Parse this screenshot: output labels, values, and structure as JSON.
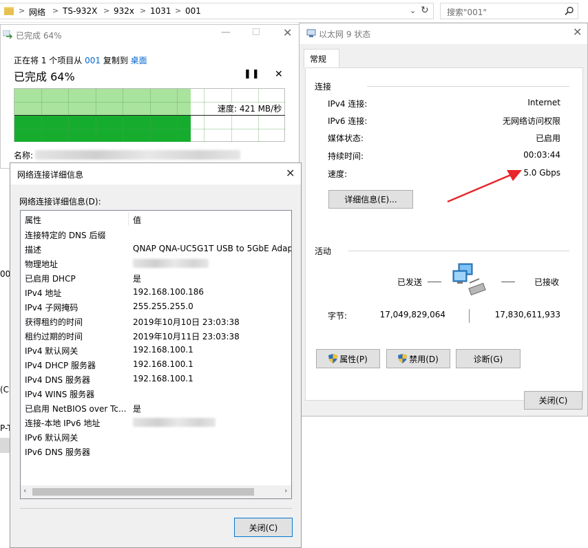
{
  "explorer": {
    "breadcrumb": [
      "网络",
      "TS-932X",
      "932x",
      "1031",
      "001"
    ],
    "search_placeholder": "搜索\"001\""
  },
  "copy_dialog": {
    "title": "已完成 64%",
    "desc_prefix": "正在将 1 个项目从",
    "desc_source": "001",
    "desc_mid": "复制到",
    "desc_dest": "桌面",
    "heading": "已完成 64%",
    "speed_label": "速度: 421 MB/秒",
    "name_label": "名称:",
    "progress_percent": 64
  },
  "ethernet_status": {
    "title": "以太网 9 状态",
    "tab": "常规",
    "connection_group": "连接",
    "rows": [
      {
        "label": "IPv4 连接:",
        "value": "Internet"
      },
      {
        "label": "IPv6 连接:",
        "value": "无网络访问权限"
      },
      {
        "label": "媒体状态:",
        "value": "已启用"
      },
      {
        "label": "持续时间:",
        "value": "00:03:44"
      },
      {
        "label": "速度:",
        "value": "5.0 Gbps"
      }
    ],
    "details_button": "详细信息(E)...",
    "activity_group": "活动",
    "sent_label": "已发送",
    "received_label": "已接收",
    "bytes_label": "字节:",
    "bytes_sent": "17,049,829,064",
    "bytes_received": "17,830,611,933",
    "properties_button": "属性(P)",
    "disable_button": "禁用(D)",
    "diagnose_button": "诊断(G)",
    "close_button": "关闭(C)"
  },
  "details_dialog": {
    "title": "网络连接详细信息",
    "list_label": "网络连接详细信息(D):",
    "col_property": "属性",
    "col_value": "值",
    "rows": [
      {
        "k": "连接特定的 DNS 后缀",
        "v": ""
      },
      {
        "k": "描述",
        "v": "QNAP QNA-UC5G1T USB to 5GbE Adap"
      },
      {
        "k": "物理地址",
        "v": ""
      },
      {
        "k": "已启用 DHCP",
        "v": "是"
      },
      {
        "k": "IPv4 地址",
        "v": "192.168.100.186"
      },
      {
        "k": "IPv4 子网掩码",
        "v": "255.255.255.0"
      },
      {
        "k": "获得租约的时间",
        "v": "2019年10月10日 23:03:38"
      },
      {
        "k": "租约过期的时间",
        "v": "2019年10月11日 23:03:38"
      },
      {
        "k": "IPv4 默认网关",
        "v": "192.168.100.1"
      },
      {
        "k": "IPv4 DHCP 服务器",
        "v": "192.168.100.1"
      },
      {
        "k": "IPv4 DNS 服务器",
        "v": "192.168.100.1"
      },
      {
        "k": "IPv4 WINS 服务器",
        "v": ""
      },
      {
        "k": "已启用 NetBIOS over Tc...",
        "v": "是"
      },
      {
        "k": "连接-本地 IPv6 地址",
        "v": ""
      },
      {
        "k": "IPv6 默认网关",
        "v": ""
      },
      {
        "k": "IPv6 DNS 服务器",
        "v": ""
      }
    ],
    "close_button": "关闭(C)"
  },
  "background_fragments": [
    "00",
    "(C:",
    "P-T"
  ],
  "colors": {
    "arrow": "#e8262b",
    "progress_green": "#16ad2e",
    "progress_light": "#a9e39d",
    "link_blue": "#0066cc"
  }
}
